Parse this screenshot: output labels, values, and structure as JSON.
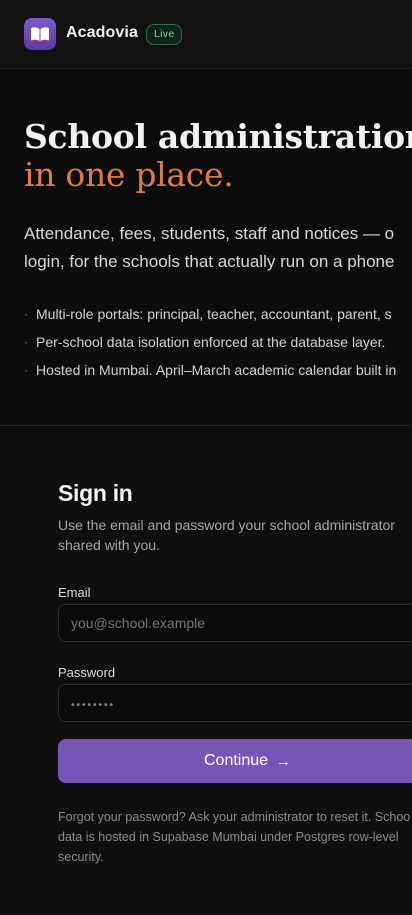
{
  "header": {
    "brand": "Acadovia",
    "badge": "Live",
    "logo_icon": "open-book-icon"
  },
  "hero": {
    "title_line": "School administration",
    "title_accent": "in one place.",
    "description_lines": [
      "Attendance, fees, students, staff and notices — o",
      "login, for the schools that actually run on a phone"
    ],
    "bullets": [
      "Multi-role portals: principal, teacher, accountant, parent, s",
      "Per-school data isolation enforced at the database layer.",
      "Hosted in Mumbai. April–March academic calendar built in"
    ]
  },
  "signin": {
    "title": "Sign in",
    "subtitle_lines": [
      "Use the email and password your school administrator",
      "shared with you."
    ],
    "email_label": "Email",
    "email_placeholder": "you@school.example",
    "password_label": "Password",
    "password_value": "••••••••",
    "continue_label": "Continue",
    "footnote_lines": [
      "Forgot your password? Ask your administrator to reset it. Schoo",
      "data is hosted in Supabase Mumbai under Postgres row-level",
      "security."
    ]
  },
  "colors": {
    "accent": "#e07b3f",
    "primary": "#7556b6",
    "live": "#7bd69a",
    "background": "#0e0e0e"
  }
}
